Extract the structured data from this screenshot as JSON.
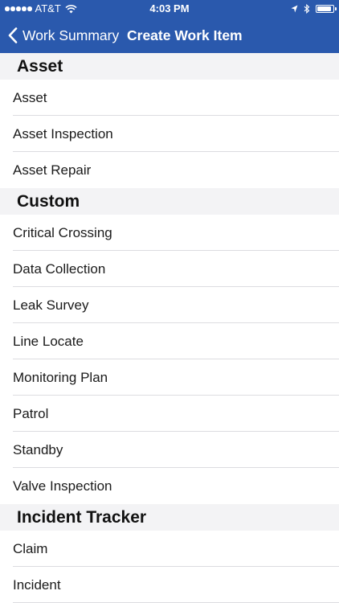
{
  "status_bar": {
    "carrier": "AT&T",
    "time": "4:03 PM",
    "battery_level": 0.9
  },
  "nav": {
    "back_label": "Work Summary",
    "title": "Create Work Item"
  },
  "colors": {
    "nav_background": "#2a59ad",
    "section_background": "#f3f3f5",
    "separator": "#dcdce0"
  },
  "icons": [
    "signal-dots-icon",
    "wifi-icon",
    "location-arrow-icon",
    "bluetooth-icon",
    "battery-icon",
    "back-chevron-icon"
  ],
  "sections": [
    {
      "title": "Asset",
      "items": [
        "Asset",
        "Asset Inspection",
        "Asset Repair"
      ]
    },
    {
      "title": "Custom",
      "items": [
        "Critical Crossing",
        "Data Collection",
        "Leak Survey",
        "Line Locate",
        "Monitoring Plan",
        "Patrol",
        "Standby",
        "Valve Inspection"
      ]
    },
    {
      "title": "Incident Tracker",
      "items": [
        "Claim",
        "Incident"
      ]
    }
  ]
}
